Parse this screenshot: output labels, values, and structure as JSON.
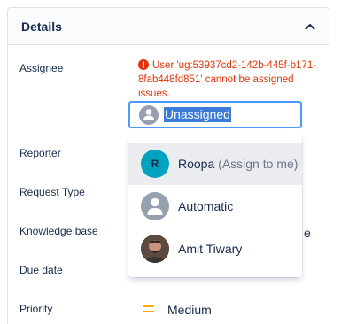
{
  "panel": {
    "title": "Details"
  },
  "fields": {
    "assignee": "Assignee",
    "reporter": "Reporter",
    "request_type": "Request Type",
    "knowledge_base": "Knowledge base",
    "due_date": "Due date",
    "priority": "Priority"
  },
  "assignee": {
    "error": "User 'ug:53937cd2-142b-445f-b171-8fab448fd851' cannot be assigned issues.",
    "input_value": "Unassigned",
    "options": [
      {
        "avatar_initial": "R",
        "name": "Roopa",
        "hint": "(Assign to me)",
        "avatar": "initial-avatar"
      },
      {
        "name": "Automatic",
        "avatar": "person-icon"
      },
      {
        "name": "Amit Tiwary",
        "avatar": "user-photo"
      }
    ]
  },
  "knowledge_base": {
    "trailing_text": "e"
  },
  "priority": {
    "value": "Medium",
    "color": "#ffab00"
  },
  "colors": {
    "error": "#de350b",
    "focus": "#4c9aff",
    "selection": "#3d7bd9"
  }
}
